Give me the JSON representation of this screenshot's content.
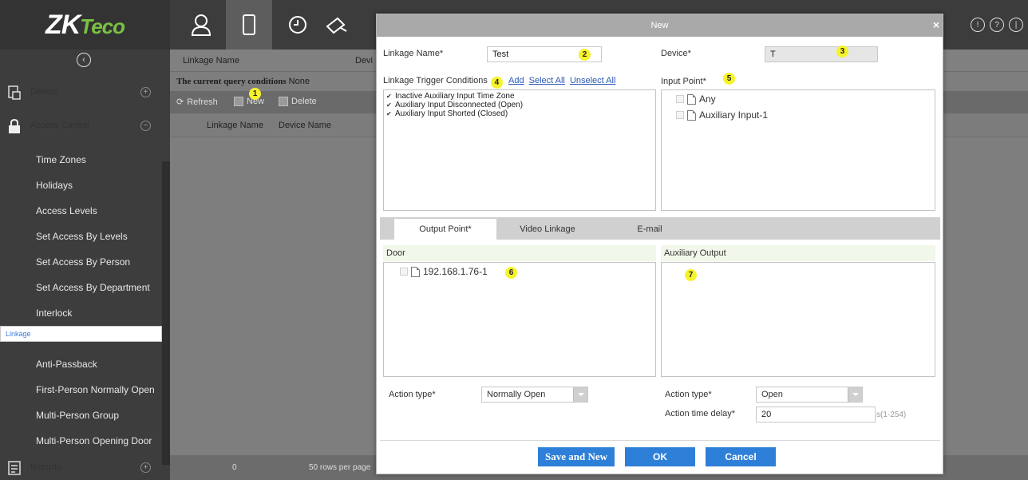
{
  "app": {
    "logo_main": "ZK",
    "logo_sub": "Teco"
  },
  "colors": {
    "accent": "#2e7fd8",
    "badge": "#f6f32a",
    "sidebar_bg": "#3d3d3d",
    "link": "#2a58b5"
  },
  "top_icons": [
    "person-icon",
    "door-icon",
    "clock-icon",
    "camera-icon"
  ],
  "top_right_icons": [
    "info-icon",
    "help-icon",
    "power-icon"
  ],
  "sidebar": {
    "device_label": "Device",
    "access_label": "Access Control",
    "reports_label": "Reports",
    "items": [
      {
        "label": "Time Zones"
      },
      {
        "label": "Holidays"
      },
      {
        "label": "Access Levels"
      },
      {
        "label": "Set Access By Levels"
      },
      {
        "label": "Set Access By Person"
      },
      {
        "label": "Set Access By Department"
      },
      {
        "label": "Interlock"
      },
      {
        "label": "Linkage"
      },
      {
        "label": "Anti-Passback"
      },
      {
        "label": "First-Person Normally Open"
      },
      {
        "label": "Multi-Person Group"
      },
      {
        "label": "Multi-Person Opening Door"
      }
    ]
  },
  "main": {
    "query_col1": "Linkage Name",
    "query_col2": "Devi",
    "cond_label": "The current query conditions",
    "cond_value": "None",
    "refresh": "Refresh",
    "new": "New",
    "delete": "Delete",
    "th_name": "Linkage Name",
    "th_device": "Device Name",
    "page_num": "0",
    "rows_per_page": "50 rows per page"
  },
  "dialog": {
    "title": "New",
    "linkage_name_label": "Linkage Name*",
    "linkage_name_value": "Test",
    "device_label": "Device*",
    "device_value": "T",
    "trigger_label": "Linkage Trigger Conditions",
    "add": "Add",
    "select_all": "Select All",
    "unselect_all": "Unselect All",
    "triggers": [
      "Inactive Auxiliary Input Time Zone",
      "Auxiliary Input Disconnected (Open)",
      "Auxiliary Input Shorted (Closed)"
    ],
    "input_point_label": "Input Point*",
    "input_points": [
      "Any",
      "Auxiliary Input-1"
    ],
    "tabs": [
      "Output Point*",
      "Video Linkage",
      "E-mail"
    ],
    "door_label": "Door",
    "door_item": "192.168.1.76-1",
    "aux_output_label": "Auxiliary Output",
    "action_type_label": "Action type*",
    "door_action": "Normally Open",
    "aux_action": "Open",
    "delay_label": "Action time delay*",
    "delay_value": "20",
    "delay_range": "s(1-254)",
    "save_new": "Save and New",
    "ok": "OK",
    "cancel": "Cancel"
  },
  "badges": [
    "1",
    "2",
    "3",
    "4",
    "5",
    "6",
    "7"
  ]
}
